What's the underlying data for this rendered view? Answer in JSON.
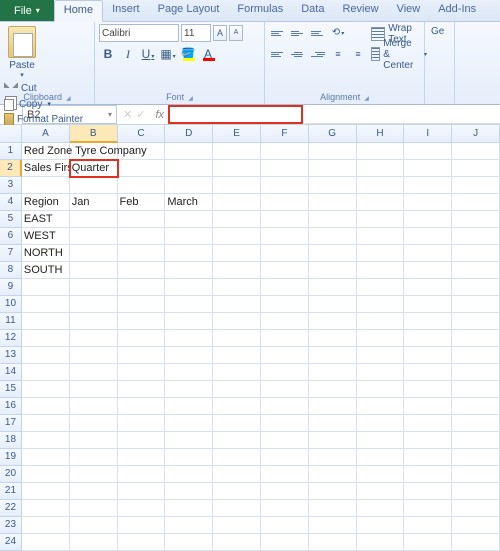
{
  "tabs": {
    "file": "File",
    "home": "Home",
    "insert": "Insert",
    "pageLayout": "Page Layout",
    "formulas": "Formulas",
    "data": "Data",
    "review": "Review",
    "view": "View",
    "addins": "Add-Ins"
  },
  "clipboard": {
    "paste": "Paste",
    "cut": "Cut",
    "copy": "Copy",
    "formatPainter": "Format Painter",
    "label": "Clipboard"
  },
  "font": {
    "name": "Calibri",
    "size": "11",
    "bold": "B",
    "italic": "I",
    "underline": "U",
    "fill": "A",
    "color": "A",
    "label": "Font"
  },
  "alignment": {
    "wrap": "Wrap Text",
    "merge": "Merge & Center",
    "label": "Alignment"
  },
  "partial": {
    "general": "Ge"
  },
  "nameBox": "B2",
  "formulaBar": "",
  "columns": [
    "A",
    "B",
    "C",
    "D",
    "E",
    "F",
    "G",
    "H",
    "I",
    "J"
  ],
  "cells": {
    "A1": "Red Zone Tyre Company",
    "A2": "Sales First",
    "B2": "Quarter",
    "A4": "Region",
    "B4": "Jan",
    "C4": "Feb",
    "D4": "March",
    "A5": "EAST",
    "A6": "WEST",
    "A7": "NORTH",
    "A8": "SOUTH"
  },
  "rowCount": 24
}
